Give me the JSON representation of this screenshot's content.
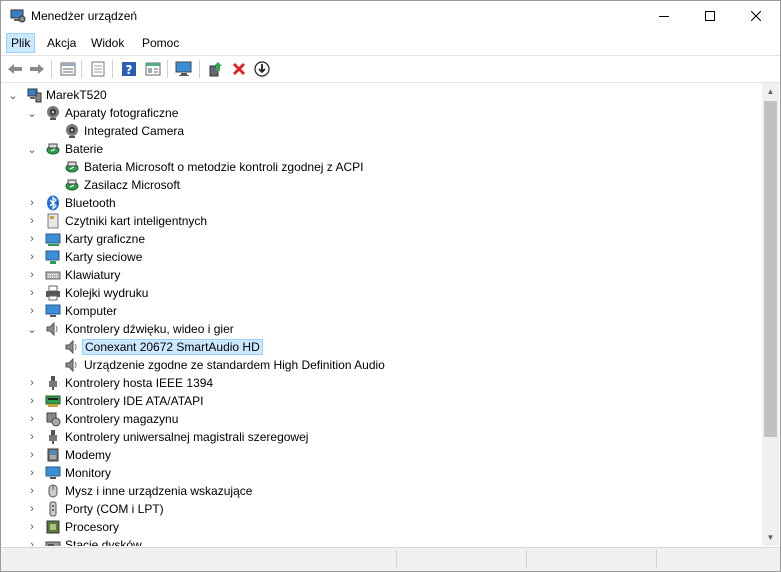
{
  "window": {
    "title": "Menedżer urządzeń"
  },
  "menu": [
    {
      "label": "Plik",
      "active": true
    },
    {
      "label": "Akcja"
    },
    {
      "label": "Widok"
    },
    {
      "label": "Pomoc"
    }
  ],
  "toolbar": [
    "back-icon",
    "forward-icon",
    "properties-grid-icon",
    "show-hidden-icon",
    "help-icon",
    "action-view-icon",
    "monitor-scan-icon",
    "update-driver-icon",
    "uninstall-icon",
    "download-icon"
  ],
  "tree": {
    "root": "MarekT520",
    "nodes": [
      {
        "label": "Aparaty fotograficzne",
        "icon": "camera-icon",
        "expanded": true,
        "children": [
          {
            "label": "Integrated Camera",
            "icon": "camera-icon"
          }
        ]
      },
      {
        "label": "Baterie",
        "icon": "battery-icon",
        "expanded": true,
        "children": [
          {
            "label": "Bateria Microsoft o metodzie kontroli zgodnej z ACPI",
            "icon": "battery-icon"
          },
          {
            "label": "Zasilacz Microsoft",
            "icon": "battery-icon"
          }
        ]
      },
      {
        "label": "Bluetooth",
        "icon": "bluetooth-icon"
      },
      {
        "label": "Czytniki kart inteligentnych",
        "icon": "smartcard-reader-icon"
      },
      {
        "label": "Karty graficzne",
        "icon": "display-adapter-icon"
      },
      {
        "label": "Karty sieciowe",
        "icon": "network-adapter-icon"
      },
      {
        "label": "Klawiatury",
        "icon": "keyboard-icon"
      },
      {
        "label": "Kolejki wydruku",
        "icon": "printer-icon"
      },
      {
        "label": "Komputer",
        "icon": "computer-icon"
      },
      {
        "label": "Kontrolery dźwięku, wideo i gier",
        "icon": "speaker-icon",
        "expanded": true,
        "children": [
          {
            "label": "Conexant 20672 SmartAudio HD",
            "icon": "speaker-icon",
            "selected": true
          },
          {
            "label": "Urządzenie zgodne ze standardem High Definition Audio",
            "icon": "speaker-icon"
          }
        ]
      },
      {
        "label": "Kontrolery hosta IEEE 1394",
        "icon": "usb-plug-icon"
      },
      {
        "label": "Kontrolery IDE ATA/ATAPI",
        "icon": "ide-controller-icon"
      },
      {
        "label": "Kontrolery magazynu",
        "icon": "storage-controller-icon"
      },
      {
        "label": "Kontrolery uniwersalnej magistrali szeregowej",
        "icon": "usb-plug-icon"
      },
      {
        "label": "Modemy",
        "icon": "modem-icon"
      },
      {
        "label": "Monitory",
        "icon": "monitor-icon"
      },
      {
        "label": "Mysz i inne urządzenia wskazujące",
        "icon": "mouse-icon"
      },
      {
        "label": "Porty (COM i LPT)",
        "icon": "port-icon"
      },
      {
        "label": "Procesory",
        "icon": "processor-icon"
      },
      {
        "label": "Stacje dysków",
        "icon": "disk-drive-icon"
      }
    ]
  },
  "colors": {
    "selection_bg": "#cce8ff",
    "selection_border": "#99d1ff",
    "close_red": "#e81123"
  }
}
